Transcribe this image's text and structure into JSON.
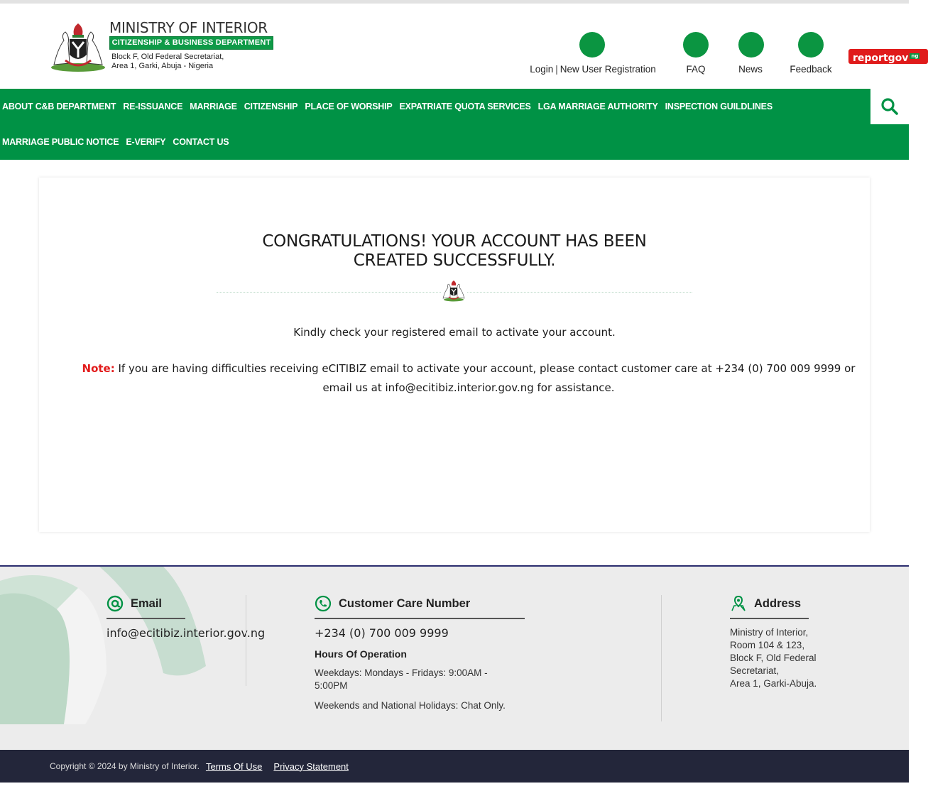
{
  "header": {
    "logo_title": "MINISTRY OF INTERIOR",
    "logo_dept": "CITIZENSHIP & BUSINESS DEPARTMENT",
    "logo_addr1": "Block F, Old Federal Secretariat,",
    "logo_addr2": "Area 1, Garki, Abuja - Nigeria",
    "login": "Login",
    "separator": "|",
    "new_user": "New User Registration",
    "faq": "FAQ",
    "news": "News",
    "feedback": "Feedback",
    "reportgov": "reportgov",
    "reportgov_suffix": "ng"
  },
  "nav": {
    "row1": [
      "ABOUT C&B DEPARTMENT",
      "RE-ISSUANCE",
      "MARRIAGE",
      "CITIZENSHIP",
      "PLACE OF WORSHIP",
      "EXPATRIATE QUOTA SERVICES",
      "LGA MARRIAGE AUTHORITY",
      "INSPECTION GUILDLINES"
    ],
    "row2": [
      "MARRIAGE PUBLIC NOTICE",
      "E-VERIFY",
      "CONTACT US"
    ]
  },
  "main": {
    "heading_line1": "CONGRATULATIONS! YOUR ACCOUNT HAS BEEN",
    "heading_line2": "CREATED SUCCESSFULLY.",
    "message": "Kindly check your registered email to activate your account.",
    "note_label": "Note:",
    "note_line1": " If you are having difficulties receiving eCITIBIZ email to activate your account, please contact customer care at +234 (0) 700 009 9999 or",
    "note_line2": "email us at info@ecitibiz.interior.gov.ng for assistance."
  },
  "footer": {
    "email_title": "Email",
    "email_value": "info@ecitibiz.interior.gov.ng",
    "care_title": "Customer Care Number",
    "care_value": "+234 (0) 700 009 9999",
    "hours_title": "Hours Of Operation",
    "hours_weekdays": "Weekdays: Mondays - Fridays: 9:00AM - 5:00PM",
    "hours_weekends": "Weekends and National Holidays: Chat Only.",
    "address_title": "Address",
    "address_lines": [
      "Ministry of Interior,",
      "Room 104 & 123,",
      "Block F, Old Federal",
      "Secretariat,",
      "Area 1, Garki-Abuja."
    ]
  },
  "bottom": {
    "copyright": "Copyright © 2024 by Ministry of Interior.",
    "terms": "Terms Of Use",
    "privacy": "Privacy Statement"
  },
  "colors": {
    "brand_green": "#009245",
    "note_red": "#e21b1b",
    "footer_dark": "#23263a"
  },
  "icons": {
    "search": "search-icon",
    "email": "at-sign-icon",
    "phone": "phone-icon",
    "address": "map-pin-icon"
  }
}
